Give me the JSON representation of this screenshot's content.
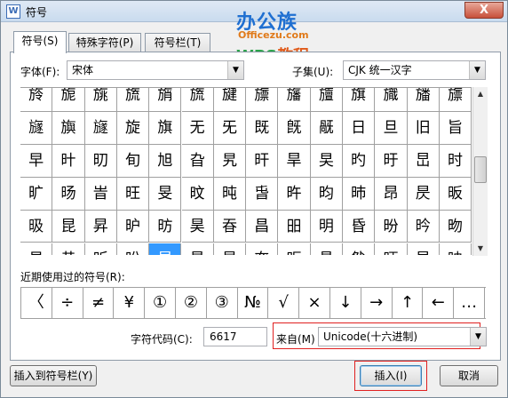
{
  "window": {
    "title": "符号",
    "app_icon": "W",
    "close_label": "X"
  },
  "logo": {
    "main": "办公族",
    "sub": "Officezu.com",
    "wps": "WPS",
    "wps_suffix": "教程"
  },
  "tabs": [
    {
      "label": "符号(S)",
      "active": true
    },
    {
      "label": "特殊字符(P)",
      "active": false
    },
    {
      "label": "符号栏(T)",
      "active": false
    }
  ],
  "font": {
    "label": "字体(F):",
    "value": "宋体"
  },
  "subset": {
    "label": "子集(U):",
    "value": "CJK 统一汉字"
  },
  "grid": {
    "rows": [
      [
        "旍",
        "旎",
        "旐",
        "旒",
        "旓",
        "旒",
        "旔",
        "旚",
        "旛",
        "旜",
        "旗",
        "旘",
        "旙",
        "旚"
      ],
      [
        "旞",
        "旟",
        "旞",
        "旋",
        "旗",
        "无",
        "旡",
        "既",
        "旣",
        "旤",
        "日",
        "旦",
        "旧",
        "旨"
      ],
      [
        "早",
        "旪",
        "旫",
        "旬",
        "旭",
        "旮",
        "旯",
        "旰",
        "旱",
        "旲",
        "旳",
        "旴",
        "旵",
        "时"
      ],
      [
        "旷",
        "旸",
        "旹",
        "旺",
        "旻",
        "旼",
        "旽",
        "旾",
        "旿",
        "昀",
        "昁",
        "昂",
        "昃",
        "昄"
      ],
      [
        "昅",
        "昆",
        "昇",
        "昈",
        "昉",
        "昊",
        "昋",
        "昌",
        "昍",
        "明",
        "昏",
        "昐",
        "昑",
        "昒"
      ],
      [
        "易",
        "昔",
        "昕",
        "昖",
        "昗",
        "昘",
        "昙",
        "昚",
        "昛",
        "昜",
        "昝",
        "昞",
        "星",
        "映"
      ]
    ],
    "selected": {
      "row": 5,
      "col": 4
    }
  },
  "recent": {
    "label": "近期使用过的符号(R):",
    "symbols": [
      "〈",
      "÷",
      "≠",
      "¥",
      "①",
      "②",
      "③",
      "№",
      "√",
      "×",
      "↓",
      "→",
      "↑",
      "←",
      "…"
    ]
  },
  "code": {
    "label": "字符代码(C):",
    "value": "6617"
  },
  "from": {
    "label": "来自(M)",
    "value": "Unicode(十六进制)"
  },
  "buttons": {
    "insert_to_bar": "插入到符号栏(Y)",
    "insert": "插入(I)",
    "cancel": "取消"
  },
  "colors": {
    "selection": "#3399ff",
    "highlight_box": "#e02020"
  }
}
